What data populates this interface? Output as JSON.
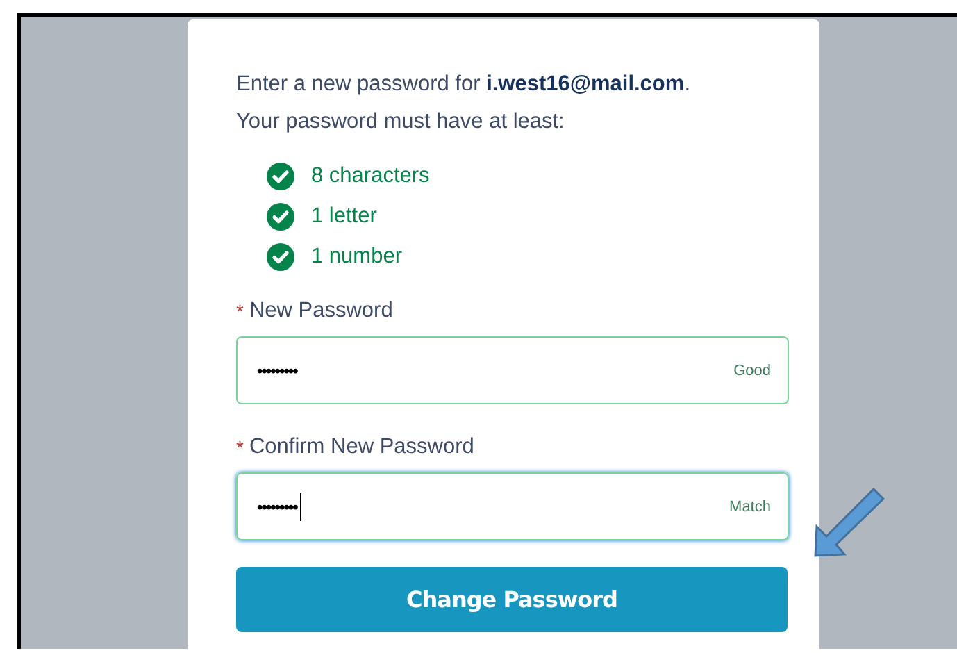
{
  "intro": "Enter a new password for **i.west16@mail.com**.",
  "rules_heading": "Your password must have at least:",
  "requirements": [
    {
      "label": "8 characters",
      "met": true
    },
    {
      "label": "1 letter",
      "met": true
    },
    {
      "label": "1 number",
      "met": true
    }
  ],
  "fields": [
    {
      "label": "New Password",
      "required_mark": "*",
      "value": "•••••••••",
      "status": "Good",
      "focused": false
    },
    {
      "label": "Confirm New Password",
      "required_mark": "*",
      "value": "•••••••••",
      "status": "Match",
      "focused": true
    }
  ],
  "submit_button": "Change Password",
  "annotation_arrow": true
}
